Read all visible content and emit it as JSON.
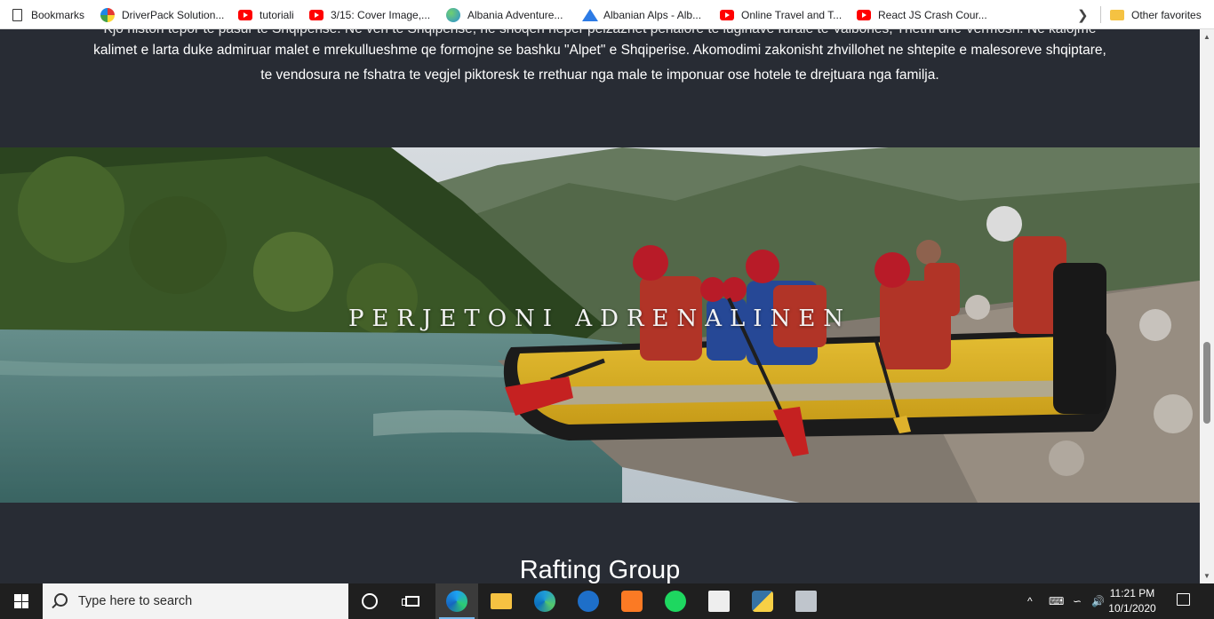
{
  "bookmarks_bar": {
    "items": [
      {
        "label": "Bookmarks",
        "icon": "page-icon"
      },
      {
        "label": "DriverPack Solution...",
        "icon": "driverpack-icon"
      },
      {
        "label": "tutoriali",
        "icon": "youtube-icon"
      },
      {
        "label": "3/15: Cover Image,...",
        "icon": "youtube-icon"
      },
      {
        "label": "Albania Adventure...",
        "icon": "globe-icon"
      },
      {
        "label": "Albanian Alps - Alb...",
        "icon": "mountain-icon"
      },
      {
        "label": "Online Travel and T...",
        "icon": "youtube-icon"
      },
      {
        "label": "React JS Crash Cour...",
        "icon": "youtube-icon"
      }
    ],
    "more_icon": "chevron-right-icon",
    "other_favorites": "Other favorites"
  },
  "intro": {
    "line0": "Kjo histori tepor te pasur te Shqiperise. Ne veri te Shqiperise, ne shoqeri heper peizazhet penalore te luginave rurale te Valbones, Thethi dhe Vermosh. Ne kalojme",
    "line1": "kalimet e larta duke admiruar malet e mrekullueshme qe formojne se bashku \"Alpet\" e Shqiperise. Akomodimi zakonisht zhvillohet ne shtepite e malesoreve shqiptare,",
    "line2": "te vendosura ne fshatra te vegjel piktoresk te rrethuar nga male te imponuar ose hotele te drejtuara nga familja."
  },
  "hero": {
    "title": "PERJETONI ADRENALINEN"
  },
  "section": {
    "heading": "Rafting Group"
  },
  "taskbar": {
    "search_placeholder": "Type here to search",
    "apps": [
      "cortana-icon",
      "task-view-icon",
      "edge-icon",
      "file-explorer-icon",
      "edge-beta-icon",
      "browser-icon",
      "xampp-icon",
      "spotify-icon",
      "counter-strike-icon",
      "python-icon",
      "network-app-icon"
    ],
    "tray": {
      "chevron": "^",
      "time": "11:21 PM",
      "date": "10/1/2020"
    }
  },
  "colors": {
    "page_background": "#282c34",
    "taskbar": "#1f1f1f",
    "active_accent": "#76b9ed"
  }
}
